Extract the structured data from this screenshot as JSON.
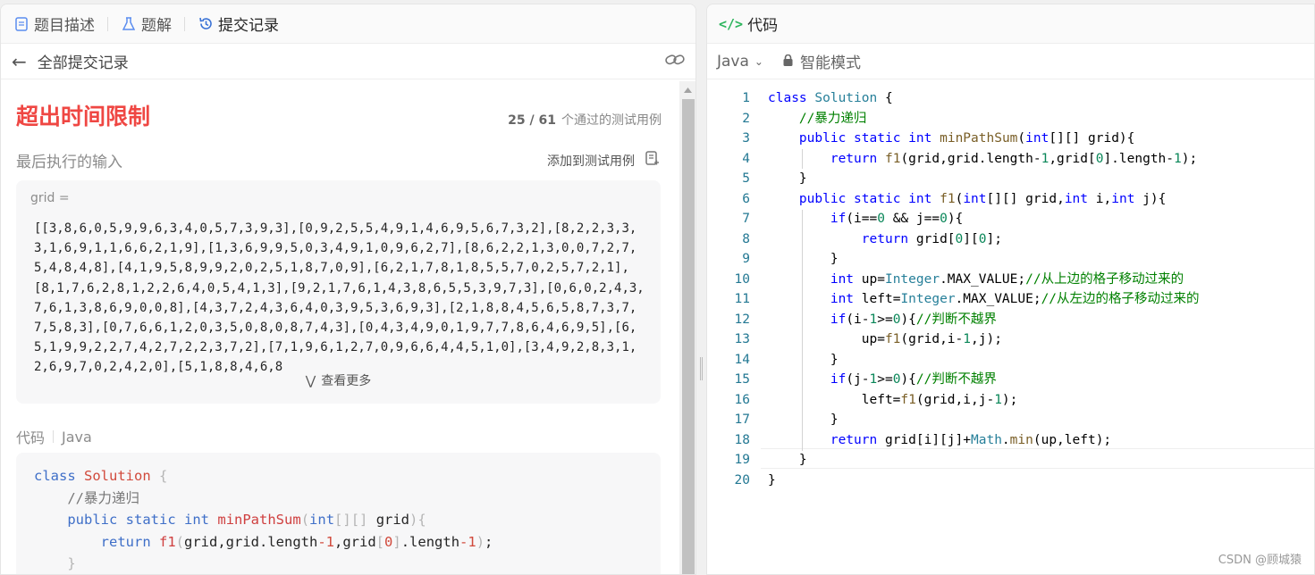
{
  "left_tabs": [
    {
      "label": "题目描述",
      "icon": "document-icon"
    },
    {
      "label": "题解",
      "icon": "flask-icon"
    },
    {
      "label": "提交记录",
      "icon": "history-icon",
      "active": true
    }
  ],
  "subbar": {
    "back_label": "全部提交记录"
  },
  "result": {
    "status": "超出时间限制",
    "passed": "25 / 61",
    "passed_label": "个通过的测试用例"
  },
  "last_input": {
    "title": "最后执行的输入",
    "add_button": "添加到测试用例",
    "var_label": "grid =",
    "value": "[[3,8,6,0,5,9,9,6,3,4,0,5,7,3,9,3],[0,9,2,5,5,4,9,1,4,6,9,5,6,7,3,2],[8,2,2,3,3,3,1,6,9,1,1,6,6,2,1,9],[1,3,6,9,9,5,0,3,4,9,1,0,9,6,2,7],[8,6,2,2,1,3,0,0,7,2,7,5,4,8,4,8],[4,1,9,5,8,9,9,2,0,2,5,1,8,7,0,9],[6,2,1,7,8,1,8,5,5,7,0,2,5,7,2,1],[8,1,7,6,2,8,1,2,2,6,4,0,5,4,1,3],[9,2,1,7,6,1,4,3,8,6,5,5,3,9,7,3],[0,6,0,2,4,3,7,6,1,3,8,6,9,0,0,8],[4,3,7,2,4,3,6,4,0,3,9,5,3,6,9,3],[2,1,8,8,4,5,6,5,8,7,3,7,7,5,8,3],[0,7,6,6,1,2,0,3,5,0,8,0,8,7,4,3],[0,4,3,4,9,0,1,9,7,7,8,6,4,6,9,5],[6,5,1,9,9,2,2,7,4,2,7,2,2,3,7,2],[7,1,9,6,1,2,7,0,9,6,6,4,4,5,1,0],[3,4,9,2,8,3,1,2,6,9,7,0,2,4,2,0],[5,1,8,8,4,6,8",
    "more": "查看更多"
  },
  "code_section": {
    "label": "代码",
    "lang": "Java"
  },
  "right": {
    "tab_label": "代码",
    "language": "Java",
    "mode": "智能模式",
    "line_numbers": [
      "1",
      "2",
      "3",
      "4",
      "5",
      "6",
      "7",
      "8",
      "9",
      "10",
      "11",
      "12",
      "13",
      "14",
      "15",
      "16",
      "17",
      "18",
      "19",
      "20"
    ]
  },
  "watermark": "CSDN @顾城猿",
  "colors": {
    "status_red": "#ef4743",
    "accent_blue": "#0000ff",
    "comment_green": "#008000"
  }
}
